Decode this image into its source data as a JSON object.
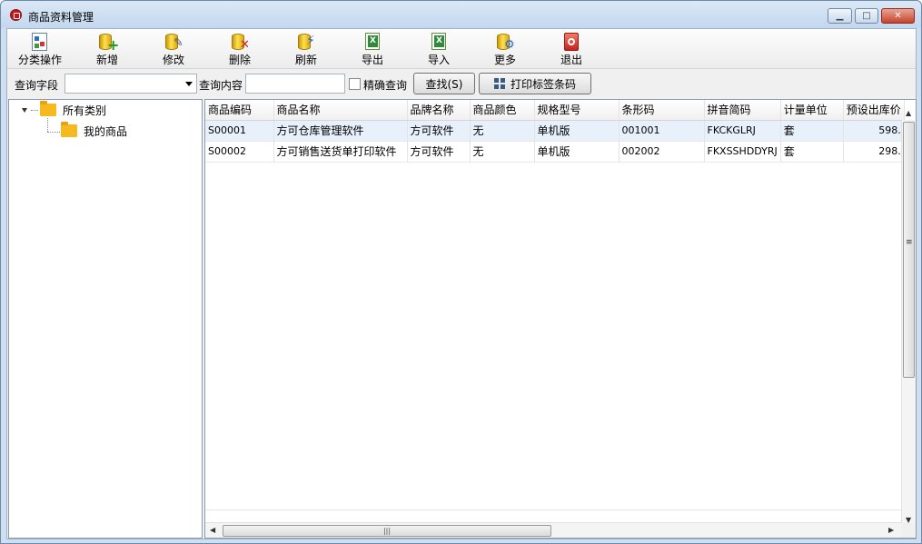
{
  "window": {
    "title": "商品资料管理"
  },
  "toolbar": {
    "items": [
      {
        "label": "分类操作",
        "icon": "category-icon"
      },
      {
        "label": "新增",
        "icon": "add-icon"
      },
      {
        "label": "修改",
        "icon": "edit-icon"
      },
      {
        "label": "删除",
        "icon": "delete-icon"
      },
      {
        "label": "刷新",
        "icon": "refresh-icon"
      },
      {
        "label": "导出",
        "icon": "export-excel-icon"
      },
      {
        "label": "导入",
        "icon": "import-excel-icon"
      },
      {
        "label": "更多",
        "icon": "more-icon"
      },
      {
        "label": "退出",
        "icon": "exit-icon"
      }
    ]
  },
  "search": {
    "field_label": "查询字段",
    "field_value": "",
    "content_label": "查询内容",
    "content_value": "",
    "exact_label": "精确查询",
    "find_label": "查找(S)",
    "print_label": "打印标签条码"
  },
  "tree": {
    "root": "所有类别",
    "children": [
      "我的商品"
    ]
  },
  "grid": {
    "columns": [
      "商品编码",
      "商品名称",
      "品牌名称",
      "商品颜色",
      "规格型号",
      "条形码",
      "拼音简码",
      "计量单位",
      "预设出库价"
    ],
    "rows": [
      [
        "S00001",
        "方可仓库管理软件",
        "方可软件",
        "无",
        "单机版",
        "001001",
        "FKCKGLRJ",
        "套",
        "598."
      ],
      [
        "S00002",
        "方可销售送货单打印软件",
        "方可软件",
        "无",
        "单机版",
        "002002",
        "FKXSSHDDYRJ",
        "套",
        "298."
      ]
    ]
  },
  "colors": {
    "selected_row": "#e8f0fb",
    "folder": "#f6b920",
    "close_button": "#c7432b"
  }
}
